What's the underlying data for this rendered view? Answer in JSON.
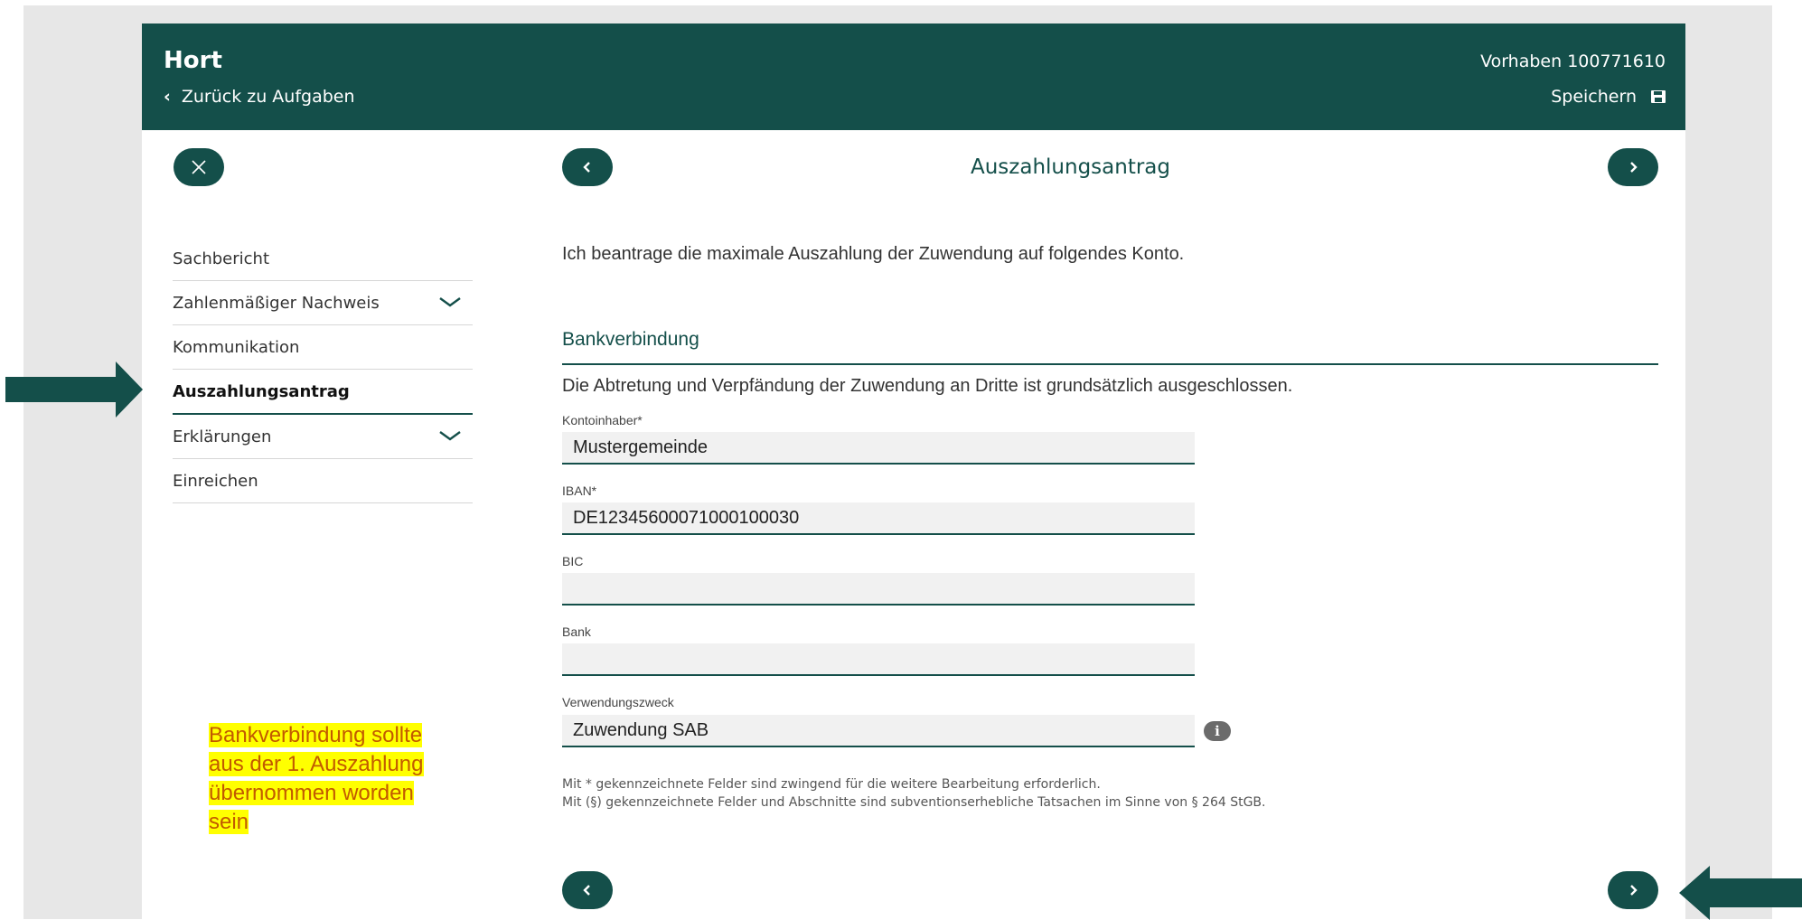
{
  "header": {
    "title": "Hort",
    "back_label": "Zurück zu Aufgaben",
    "project": "Vorhaben 100771610",
    "save_label": "Speichern"
  },
  "step": {
    "title": "Auszahlungsantrag"
  },
  "sidebar": {
    "items": [
      {
        "label": "Sachbericht",
        "expandable": false
      },
      {
        "label": "Zahlenmäßiger Nachweis",
        "expandable": true
      },
      {
        "label": "Kommunikation",
        "expandable": false
      },
      {
        "label": "Auszahlungsantrag",
        "active": true
      },
      {
        "label": "Erklärungen",
        "expandable": true
      },
      {
        "label": "Einreichen",
        "expandable": false
      }
    ]
  },
  "main": {
    "intro": "Ich beantrage die maximale Auszahlung der Zuwendung auf folgendes Konto.",
    "section_title": "Bankverbindung",
    "exclusion": "Die Abtretung und Verpfändung der Zuwendung an Dritte ist grundsätzlich ausgeschlossen.",
    "fields": {
      "account_holder": {
        "label": "Kontoinhaber*",
        "value": "Mustergemeinde"
      },
      "iban": {
        "label": "IBAN*",
        "value": "DE12345600071000100030"
      },
      "bic": {
        "label": "BIC",
        "value": ""
      },
      "bank": {
        "label": "Bank",
        "value": ""
      },
      "purpose": {
        "label": "Verwendungszweck",
        "value": "Zuwendung SAB"
      }
    },
    "info_icon": "i",
    "footnote_required": "Mit * gekennzeichnete Felder sind zwingend für die weitere Bearbeitung erforderlich.",
    "footnote_subsidy": "Mit (§) gekennzeichnete Felder und Abschnitte sind subventionserhebliche Tatsachen im Sinne von § 264 StGB."
  },
  "annotation": {
    "lines": [
      "Bankverbindung sollte",
      "aus der 1. Auszahlung",
      "übernommen worden",
      "sein"
    ]
  },
  "colors": {
    "primary": "#144f4a",
    "highlight": "#ffff00",
    "annotation_text": "#c25a00",
    "backdrop": "#e7e7e7"
  }
}
